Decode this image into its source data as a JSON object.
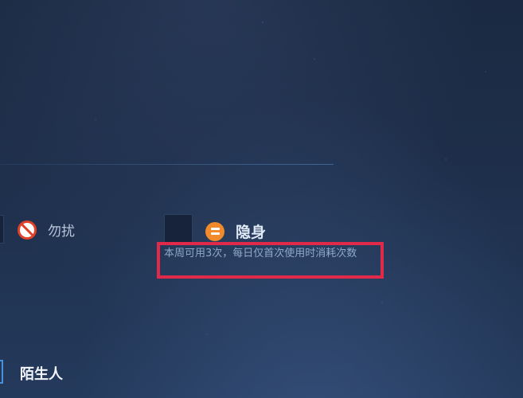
{
  "status_options": {
    "do_not_disturb": {
      "label": "勿扰",
      "icon": "do-not-disturb-icon",
      "icon_color": "#e04128"
    },
    "invisible": {
      "label": "隐身",
      "icon": "invisible-icon",
      "icon_color": "#f08a2a"
    }
  },
  "invisible_tip": "本周可用3次，每日仅首次使用时消耗次数",
  "friend_group": {
    "label": "陌生人"
  },
  "highlight_color": "#e12a4a"
}
